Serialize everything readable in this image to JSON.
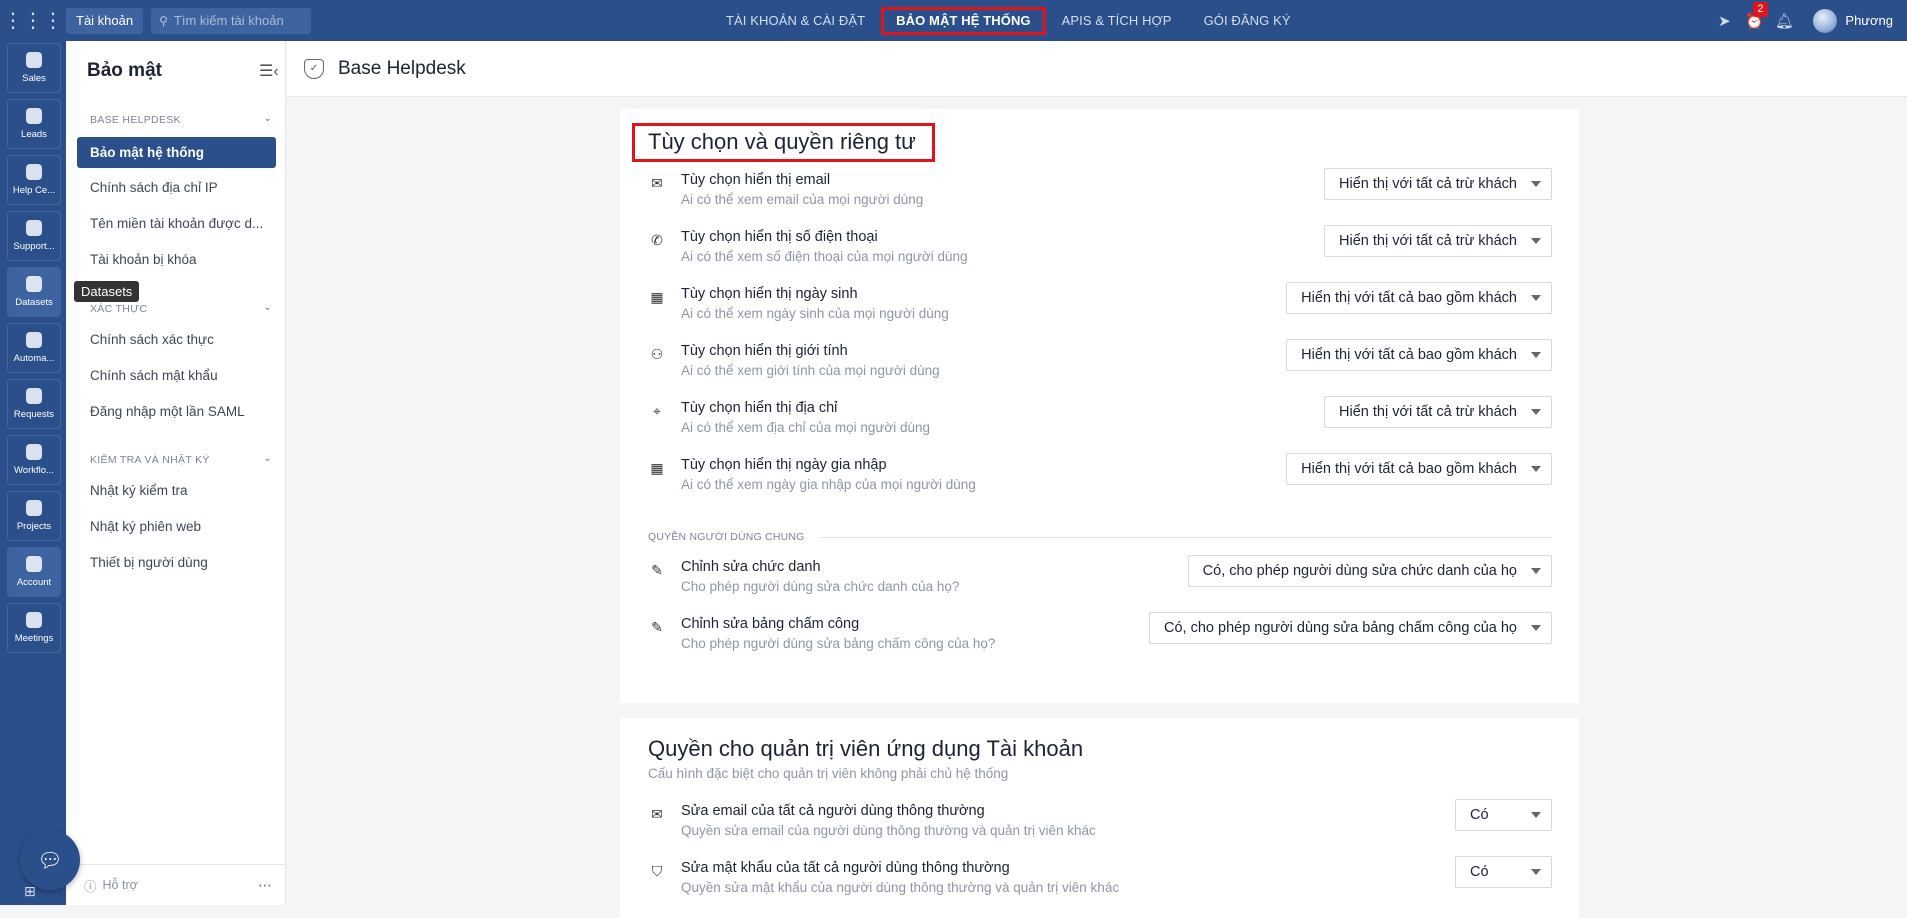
{
  "topbar": {
    "app_label": "Tài khoản",
    "search_placeholder": "Tìm kiếm tài khoản",
    "nav": [
      {
        "label": "TÀI KHOẢN & CÀI ĐẶT"
      },
      {
        "label": "BẢO MẬT HỆ THỐNG"
      },
      {
        "label": "APIS & TÍCH HỢP"
      },
      {
        "label": "GÓI ĐĂNG KÝ"
      }
    ],
    "notification_count": "2",
    "user_name": "Phương"
  },
  "rail": {
    "items": [
      {
        "label": "Sales"
      },
      {
        "label": "Leads"
      },
      {
        "label": "Help Ce..."
      },
      {
        "label": "Support..."
      },
      {
        "label": "Datasets"
      },
      {
        "label": "Automa..."
      },
      {
        "label": "Requests"
      },
      {
        "label": "Workflo..."
      },
      {
        "label": "Projects"
      },
      {
        "label": "Account"
      },
      {
        "label": "Meetings"
      }
    ],
    "tooltip": "Datasets"
  },
  "sidebar": {
    "title": "Bảo mật",
    "sections": [
      {
        "title": "BASE HELPDESK",
        "items": [
          "Bảo mật hệ thống",
          "Chính sách địa chỉ IP",
          "Tên miền tài khoản được d...",
          "Tài khoản bị khóa"
        ]
      },
      {
        "title": "XÁC THỰC",
        "items": [
          "Chính sách xác thực",
          "Chính sách mật khẩu",
          "Đăng nhập một lần SAML"
        ]
      },
      {
        "title": "KIỂM TRA VÀ NHẬT KÝ",
        "items": [
          "Nhật ký kiểm tra",
          "Nhật ký phiên web",
          "Thiết bị người dùng"
        ]
      }
    ],
    "footer_label": "Hỗ trợ"
  },
  "main": {
    "header_title": "Base Helpdesk",
    "privacy": {
      "title": "Tùy chọn và quyền riêng tư",
      "rows": [
        {
          "label": "Tùy chọn hiển thị email",
          "desc": "Ai có thể xem email của mọi người dùng",
          "value": "Hiển thị với tất cả trừ khách",
          "icon": "mail-icon"
        },
        {
          "label": "Tùy chọn hiển thị số điện thoại",
          "desc": "Ai có thể xem số điện thoại của mọi người dùng",
          "value": "Hiển thị với tất cả trừ khách",
          "icon": "phone-icon"
        },
        {
          "label": "Tùy chọn hiển thị ngày sinh",
          "desc": "Ai có thể xem ngày sinh của mọi người dùng",
          "value": "Hiển thị với tất cả bao gồm khách",
          "icon": "calendar-icon"
        },
        {
          "label": "Tùy chọn hiển thị giới tính",
          "desc": "Ai có thể xem giới tính của mọi người dùng",
          "value": "Hiển thị với tất cả bao gồm khách",
          "icon": "user-check-icon"
        },
        {
          "label": "Tùy chọn hiển thị địa chỉ",
          "desc": "Ai có thể xem địa chỉ của mọi người dùng",
          "value": "Hiển thị với tất cả trừ khách",
          "icon": "map-pin-icon"
        },
        {
          "label": "Tùy chọn hiển thị ngày gia nhập",
          "desc": "Ai có thể xem ngày gia nhập của mọi người dùng",
          "value": "Hiển thị với tất cả bao gồm khách",
          "icon": "calendar-icon"
        }
      ],
      "divider": "QUYỀN NGƯỜI DÙNG CHUNG",
      "general_rows": [
        {
          "label": "Chỉnh sửa chức danh",
          "desc": "Cho phép người dùng sửa chức danh của họ?",
          "value": "Có, cho phép người dùng sửa chức danh của họ",
          "icon": "edit-icon"
        },
        {
          "label": "Chỉnh sửa bảng chấm công",
          "desc": "Cho phép người dùng sửa bảng chấm công của họ?",
          "value": "Có, cho phép người dùng sửa bảng chấm công của họ",
          "icon": "edit-icon"
        }
      ]
    },
    "admin": {
      "title": "Quyền cho quản trị viên ứng dụng Tài khoản",
      "subtitle": "Cấu hình đặc biệt cho quản trị viên không phải chủ hệ thống",
      "rows": [
        {
          "label": "Sửa email của tất cả người dùng thông thường",
          "desc": "Quyền sửa email của người dùng thông thường và quản trị viên khác",
          "value": "Có",
          "icon": "mail-icon"
        },
        {
          "label": "Sửa mật khẩu của tất cả người dùng thông thường",
          "desc": "Quyền sửa mật khẩu của người dùng thông thường và quản trị viên khác",
          "value": "Có",
          "icon": "shield-icon"
        }
      ]
    }
  }
}
